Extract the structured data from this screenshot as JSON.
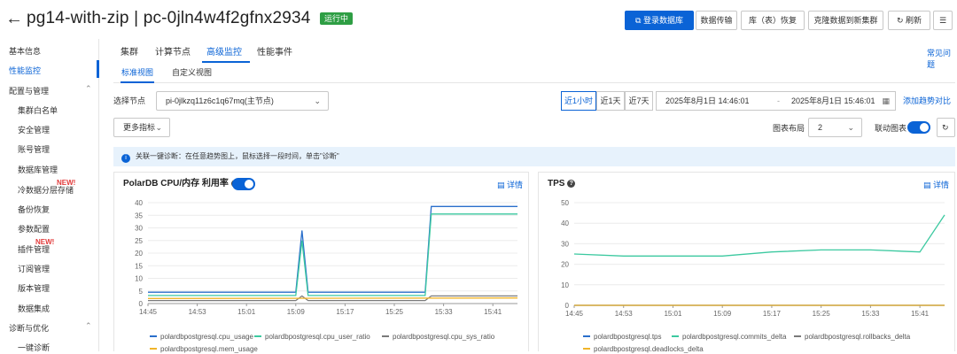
{
  "header": {
    "title": "pg14-with-zip | pc-0jln4w4f2gfnx2934",
    "status": "运行中",
    "buttons": [
      "登录数据库",
      "数据传输",
      "库（表）恢复",
      "克隆数据到新集群",
      "刷新"
    ]
  },
  "sidebar": {
    "items": [
      "基本信息",
      "性能监控",
      "配置与管理",
      "集群白名单",
      "安全管理",
      "账号管理",
      "数据库管理",
      "冷数据分层存储",
      "备份恢复",
      "参数配置",
      "插件管理",
      "订阅管理",
      "版本管理",
      "数据集成",
      "诊断与优化",
      "一键诊断"
    ],
    "new_badge": "NEW!"
  },
  "tabs": [
    "集群",
    "计算节点",
    "高级监控",
    "性能事件"
  ],
  "faq": "常见问题",
  "subtabs": [
    "标准视图",
    "自定义视图"
  ],
  "filters": {
    "node_label": "选择节点",
    "node_value": "pi-0jlkzq11z6c1q67mq(主节点)",
    "ranges": [
      "近1小时",
      "近1天",
      "近7天"
    ],
    "start": "2025年8月1日 14:46:01",
    "end": "2025年8月1日 15:46:01",
    "add_compare": "添加趋势对比",
    "more_metrics": "更多指标",
    "layout_label": "图表布局",
    "layout_value": "2",
    "link_label": "联动图表"
  },
  "notice": "关联一键诊断：在任意趋势图上，鼠标选择一段时间，单击\"诊断\"",
  "detail_label": "详情",
  "colors": {
    "blue": "#2a6fcb",
    "green": "#3cc9a0",
    "gray": "#7a7a7a",
    "yellow": "#f0b429",
    "accent": "#0a63d6"
  },
  "chart_data": [
    {
      "type": "line",
      "title": "PolarDB CPU/内存 利用率",
      "x_ticks": [
        "14:45",
        "14:53",
        "15:01",
        "15:09",
        "15:17",
        "15:25",
        "15:33",
        "15:41"
      ],
      "ylim": [
        0,
        40
      ],
      "y_ticks": [
        0,
        5,
        10,
        15,
        20,
        25,
        30,
        35,
        40
      ],
      "series": [
        {
          "name": "polardbpostgresql.cpu_usage",
          "color": "#2a6fcb",
          "x_minutes": [
            0,
            24,
            25,
            26,
            27,
            45,
            46,
            60
          ],
          "values": [
            4.5,
            4.5,
            29,
            4.5,
            4.5,
            4.5,
            38.5,
            38.5
          ]
        },
        {
          "name": "polardbpostgresql.cpu_user_ratio",
          "color": "#3cc9a0",
          "x_minutes": [
            0,
            24,
            25,
            26,
            27,
            45,
            46,
            60
          ],
          "values": [
            3.2,
            3.2,
            25,
            3.2,
            3.2,
            3.2,
            35.5,
            35.5
          ]
        },
        {
          "name": "polardbpostgresql.cpu_sys_ratio",
          "color": "#7a7a7a",
          "x_minutes": [
            0,
            24,
            25,
            26,
            27,
            45,
            46,
            60
          ],
          "values": [
            1.2,
            1.2,
            3,
            1.2,
            1.2,
            1.2,
            3,
            3
          ]
        },
        {
          "name": "polardbpostgresql.mem_usage",
          "color": "#f0b429",
          "x_minutes": [
            0,
            60
          ],
          "values": [
            2,
            2.2
          ]
        }
      ]
    },
    {
      "type": "line",
      "title": "TPS",
      "x_ticks": [
        "14:45",
        "14:53",
        "15:01",
        "15:09",
        "15:17",
        "15:25",
        "15:33",
        "15:41"
      ],
      "ylim": [
        0,
        50
      ],
      "y_ticks": [
        0,
        10,
        20,
        30,
        40,
        50
      ],
      "series": [
        {
          "name": "polardbpostgresql.tps",
          "color": "#2a6fcb",
          "x_minutes": [
            0,
            60
          ],
          "values": [
            0,
            0
          ]
        },
        {
          "name": "polardbpostgresql.commits_delta",
          "color": "#3cc9a0",
          "x_minutes": [
            0,
            8,
            16,
            24,
            32,
            40,
            48,
            56,
            60
          ],
          "values": [
            25,
            24,
            24,
            24,
            26,
            27,
            27,
            26,
            44
          ]
        },
        {
          "name": "polardbpostgresql.rollbacks_delta",
          "color": "#7a7a7a",
          "x_minutes": [
            0,
            60
          ],
          "values": [
            0,
            0
          ]
        },
        {
          "name": "polardbpostgresql.deadlocks_delta",
          "color": "#f0b429",
          "x_minutes": [
            0,
            60
          ],
          "values": [
            0,
            0
          ]
        }
      ]
    }
  ]
}
